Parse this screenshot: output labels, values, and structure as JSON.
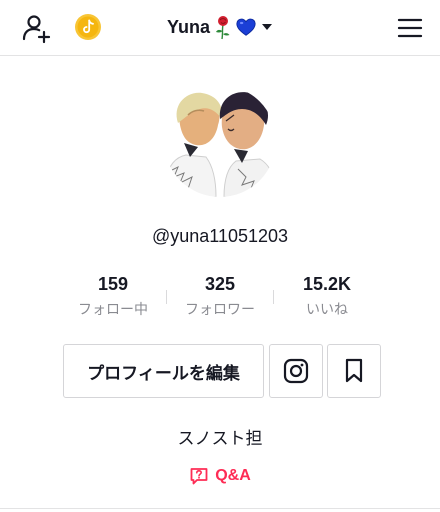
{
  "header": {
    "username": "Yuna",
    "add_user_icon": "add-user-icon",
    "coin_icon": "tiktok-coin-icon",
    "rose_icon": "rose-icon",
    "heart_icon": "blue-heart-icon",
    "dropdown_icon": "caret-down-icon",
    "menu_icon": "hamburger-menu-icon"
  },
  "profile": {
    "handle": "@yuna11051203",
    "bio": "スノスト担"
  },
  "stats": [
    {
      "value": "159",
      "label": "フォロー中"
    },
    {
      "value": "325",
      "label": "フォロワー"
    },
    {
      "value": "15.2K",
      "label": "いいね"
    }
  ],
  "actions": {
    "edit_profile": "プロフィールを編集",
    "instagram_icon": "instagram-icon",
    "bookmark_icon": "bookmark-icon"
  },
  "qa": {
    "label": "Q&A"
  },
  "colors": {
    "accent": "#fe2c55",
    "coin": "#f8c535",
    "heart": "#1b3fd6",
    "text": "#161823",
    "muted": "#8a8b91"
  }
}
